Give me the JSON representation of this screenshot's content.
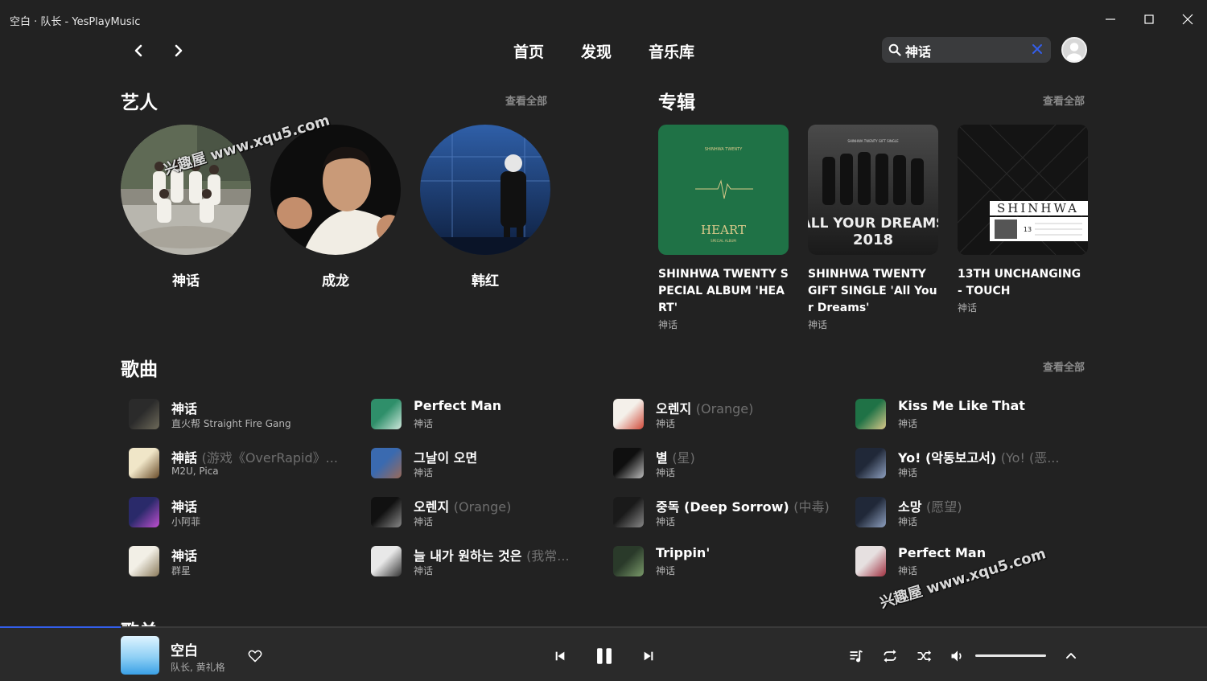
{
  "window": {
    "title": "空白 · 队长 - YesPlayMusic"
  },
  "nav": {
    "links": [
      "首页",
      "发现",
      "音乐库"
    ]
  },
  "search": {
    "value": "神话"
  },
  "artists_section": {
    "title": "艺人",
    "see_all": "查看全部",
    "items": [
      {
        "name": "神话"
      },
      {
        "name": "成龙"
      },
      {
        "name": "韩红"
      }
    ]
  },
  "albums_section": {
    "title": "专辑",
    "see_all": "查看全部",
    "items": [
      {
        "name": "SHINHWA TWENTY SPECIAL ALBUM 'HEART'",
        "artist": "神话",
        "cover_text": "HEART",
        "cover_subtext": "SPECIAL ALBUM",
        "cover_top": "SHINHWA TWENTY"
      },
      {
        "name": "SHINHWA TWENTY GIFT SINGLE 'All Your Dreams'",
        "artist": "神话",
        "cover_text": "ALL YOUR DREAMS",
        "cover_subtext": "2018",
        "cover_top": "SHINHWA TWENTY GIFT SINGLE"
      },
      {
        "name": "13TH UNCHANGING - TOUCH",
        "artist": "神话",
        "cover_text": "SHINHWA",
        "cover_subtext": "13"
      }
    ]
  },
  "songs_section": {
    "title": "歌曲",
    "see_all": "查看全部",
    "items": [
      {
        "title": "神话",
        "alias": "",
        "artist": "直火帮 Straight Fire Gang"
      },
      {
        "title": "神話",
        "alias": "(游戏《OverRapid》...",
        "artist": "M2U, Pica"
      },
      {
        "title": "神话",
        "alias": "",
        "artist": "小阿菲"
      },
      {
        "title": "神话",
        "alias": "",
        "artist": "群星"
      },
      {
        "title": "Perfect Man",
        "alias": "",
        "artist": "神话"
      },
      {
        "title": "그날이 오면",
        "alias": "",
        "artist": "神话"
      },
      {
        "title": "오렌지",
        "alias": "(Orange)",
        "artist": "神话"
      },
      {
        "title": "늘 내가 원하는 것은",
        "alias": "(我常...",
        "artist": "神话"
      },
      {
        "title": "오렌지",
        "alias": "(Orange)",
        "artist": "神话"
      },
      {
        "title": "별",
        "alias": "(星)",
        "artist": "神话"
      },
      {
        "title": "중독 (Deep Sorrow)",
        "alias": "(中毒)",
        "artist": "神话"
      },
      {
        "title": "Trippin'",
        "alias": "",
        "artist": "神话"
      },
      {
        "title": "Kiss Me Like That",
        "alias": "",
        "artist": "神话"
      },
      {
        "title": "Yo! (악동보고서)",
        "alias": "(Yo! (恶...",
        "artist": "神话"
      },
      {
        "title": "소망",
        "alias": "(愿望)",
        "artist": "神话"
      },
      {
        "title": "Perfect Man",
        "alias": "",
        "artist": "神话"
      }
    ]
  },
  "next_section": {
    "title": "歌单"
  },
  "player": {
    "title": "空白",
    "artist": "队长, 黄礼格",
    "progress": 0.1,
    "volume": 1.0
  },
  "watermark": {
    "text": "兴趣屋 www.xqu5.com"
  },
  "colors": {
    "background": "#222222",
    "accent": "#335eea",
    "muted": "#8a8a8a"
  }
}
